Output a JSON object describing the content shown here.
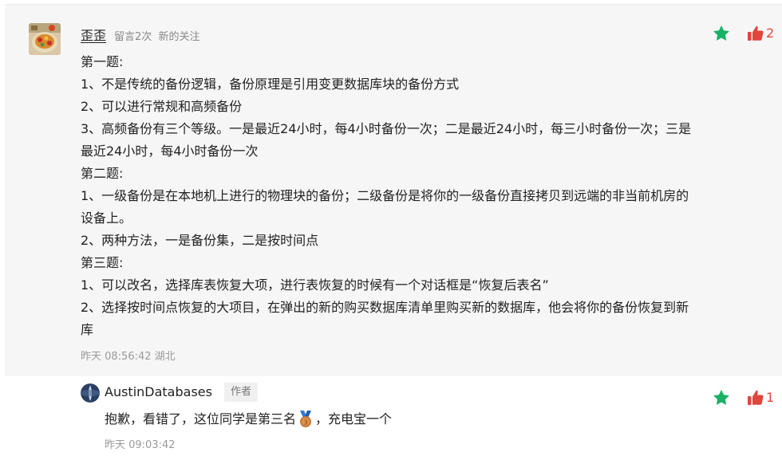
{
  "comment": {
    "username": "歪歪",
    "meta": [
      "留言2次",
      "新的关注"
    ],
    "lines": [
      "第一题:",
      "1、不是传统的备份逻辑，备份原理是引用变更数据库块的备份方式",
      "2、可以进行常规和高频备份",
      "3、高频备份有三个等级。一是最近24小时，每4小时备份一次；二是最近24小时，每三小时备份一次；三是最近24小时，每4小时备份一次",
      "第二题:",
      "1、一级备份是在本地机上进行的物理块的备份；二级备份是将你的一级备份直接拷贝到远端的非当前机房的设备上。",
      "2、两种方法，一是备份集，二是按时间点",
      "第三题:",
      "1、可以改名，选择库表恢复大项，进行表恢复的时候有一个对话框是“恢复后表名”",
      "2、选择按时间点恢复的大项目，在弹出的新的购买数据库清单里购买新的数据库，他会将你的备份恢复到新库"
    ],
    "timestamp": "昨天 08:56:42 湖北",
    "like_count": "2",
    "star_icon": "star-icon",
    "like_icon": "thumbs-up-icon"
  },
  "reply": {
    "username": "AustinDatabases",
    "badge": "作者",
    "text_before": "抱歉，看错了，这位同学是第三名",
    "text_after": "，充电宝一个",
    "medal_icon": "bronze-medal-icon",
    "timestamp": "昨天 09:03:42",
    "like_count": "1"
  },
  "colors": {
    "star": "#19b163",
    "like": "#e0463c",
    "card_bg": "#f6f6f7"
  }
}
